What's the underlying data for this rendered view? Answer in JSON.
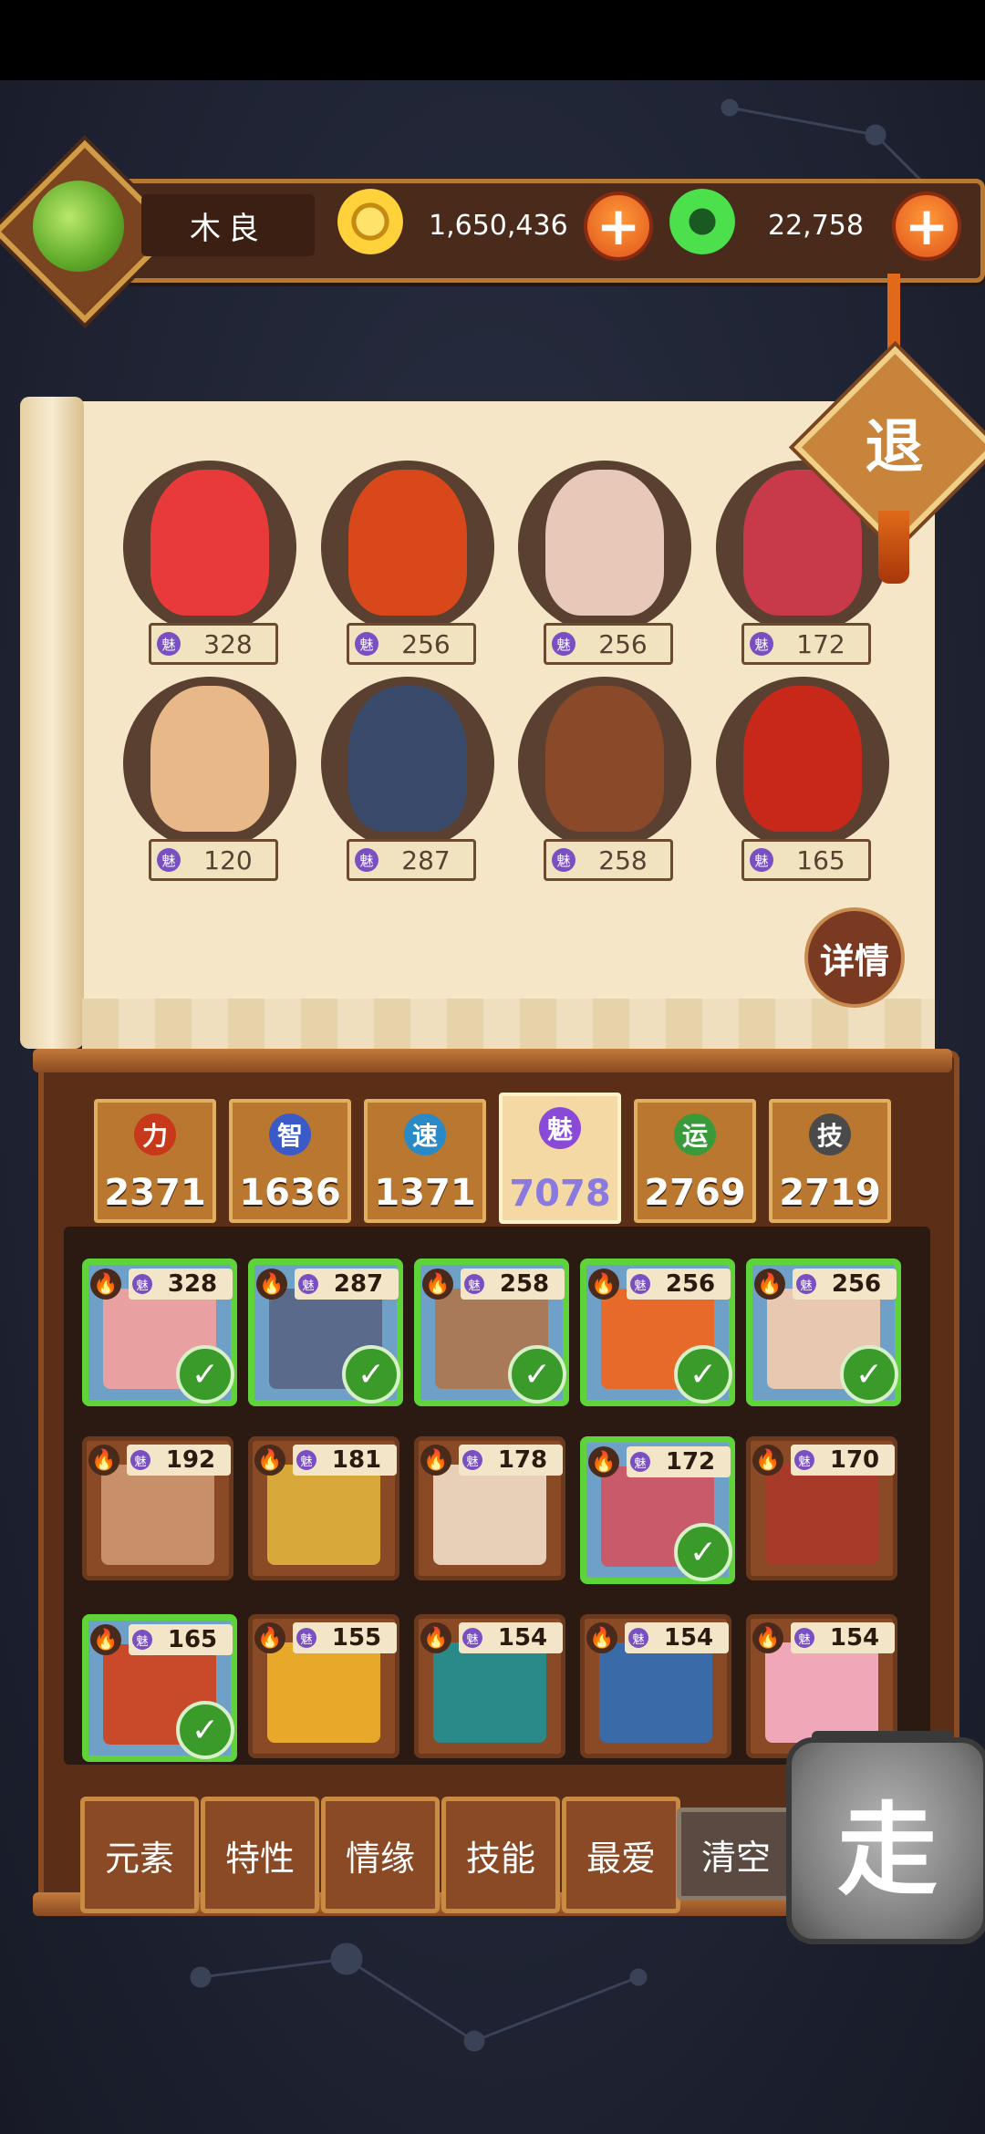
{
  "player": {
    "name": "木良",
    "avatar_icon": "jade-dragon-icon"
  },
  "currency": {
    "gold": {
      "amount": "1,650,436",
      "icon": "gold-coin-icon",
      "add_label": "+"
    },
    "jade": {
      "amount": "22,758",
      "icon": "jade-coin-icon",
      "add_label": "+"
    }
  },
  "exit_label": "退",
  "detail_label": "详情",
  "charm_glyph": "魅",
  "featured_heroes": [
    {
      "charm": "328",
      "color": "#e83a3a"
    },
    {
      "charm": "256",
      "color": "#d8481a"
    },
    {
      "charm": "256",
      "color": "#e8c8b8"
    },
    {
      "charm": "172",
      "color": "#c83a4a"
    },
    {
      "charm": "120",
      "color": "#e8b888"
    },
    {
      "charm": "287",
      "color": "#3a4a6a"
    },
    {
      "charm": "258",
      "color": "#8a4a2a"
    },
    {
      "charm": "165",
      "color": "#c8281a"
    }
  ],
  "stats": [
    {
      "label": "力",
      "value": "2371",
      "color": "#c8381a"
    },
    {
      "label": "智",
      "value": "1636",
      "color": "#3a5ac8"
    },
    {
      "label": "速",
      "value": "1371",
      "color": "#2a8ac8"
    },
    {
      "label": "魅",
      "value": "7078",
      "color": "#8a4ad8",
      "active": true
    },
    {
      "label": "运",
      "value": "2769",
      "color": "#3a9a3a"
    },
    {
      "label": "技",
      "value": "2719",
      "color": "#4a4a4a"
    }
  ],
  "roster": [
    {
      "charm": "328",
      "selected": true,
      "color": "#e8a0a0"
    },
    {
      "charm": "287",
      "selected": true,
      "color": "#5a6a8a"
    },
    {
      "charm": "258",
      "selected": true,
      "color": "#a87a5a"
    },
    {
      "charm": "256",
      "selected": true,
      "color": "#e86a2a"
    },
    {
      "charm": "256",
      "selected": true,
      "color": "#e8c8b0"
    },
    {
      "charm": "192",
      "selected": false,
      "color": "#c8906a"
    },
    {
      "charm": "181",
      "selected": false,
      "color": "#d8a83a"
    },
    {
      "charm": "178",
      "selected": false,
      "color": "#e8d0b8"
    },
    {
      "charm": "172",
      "selected": true,
      "color": "#c85a6a"
    },
    {
      "charm": "170",
      "selected": false,
      "color": "#a83a2a"
    },
    {
      "charm": "165",
      "selected": true,
      "color": "#c84a2a"
    },
    {
      "charm": "155",
      "selected": false,
      "color": "#e8a82a"
    },
    {
      "charm": "154",
      "selected": false,
      "color": "#2a8a8a"
    },
    {
      "charm": "154",
      "selected": false,
      "color": "#3a6aa8"
    },
    {
      "charm": "154",
      "selected": false,
      "color": "#f0a8b8"
    }
  ],
  "check_glyph": "✓",
  "filters": [
    "元素",
    "特性",
    "情缘",
    "技能",
    "最爱"
  ],
  "clear_label": "清空",
  "go_label": "走"
}
